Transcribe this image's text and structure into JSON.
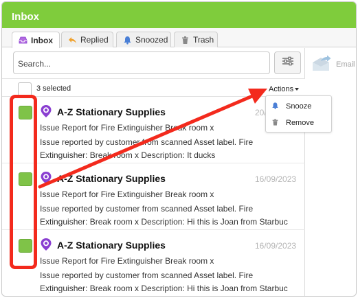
{
  "window": {
    "title": "Inbox"
  },
  "tabs": [
    {
      "label": "Inbox",
      "icon": "inbox-icon",
      "active": true
    },
    {
      "label": "Replied",
      "icon": "reply-arrow-icon",
      "active": false
    },
    {
      "label": "Snoozed",
      "icon": "bell-icon",
      "active": false
    },
    {
      "label": "Trash",
      "icon": "trash-icon",
      "active": false
    }
  ],
  "search": {
    "placeholder": "Search..."
  },
  "toolbar": {
    "selected_label": "3 selected",
    "actions_label": "Actions"
  },
  "messages": [
    {
      "sender": "A-Z Stationary Supplies",
      "date": "20/",
      "subject": "Issue Report for Fire Extinguisher Break room x",
      "preview": "Issue reported by customer from scanned Asset label. Fire Extinguisher: Break room x Description: It ducks",
      "checked": true
    },
    {
      "sender": "A-Z Stationary Supplies",
      "date": "16/09/2023",
      "subject": "Issue Report for Fire Extinguisher Break room x",
      "preview": "Issue reported by customer from scanned Asset label. Fire Extinguisher: Break room x Description: Hi this is Joan from Starbuc",
      "checked": true
    },
    {
      "sender": "A-Z Stationary Supplies",
      "date": "16/09/2023",
      "subject": "Issue Report for Fire Extinguisher Break room x",
      "preview": "Issue reported by customer from scanned Asset label. Fire Extinguisher: Break room x Description: Hi this is Joan from Starbuc",
      "checked": true
    }
  ],
  "actions_menu": [
    {
      "label": "Snooze",
      "icon": "bell-icon"
    },
    {
      "label": "Remove",
      "icon": "trash-icon"
    }
  ],
  "right_toolbar": {
    "email_label": "Email"
  },
  "colors": {
    "header_green": "#7fcc3c",
    "checkbox_green": "#7fc348",
    "avatar_purple": "#8a3fd1",
    "annotation_red": "#f32a1d",
    "date_gray": "#b5b5b5"
  }
}
